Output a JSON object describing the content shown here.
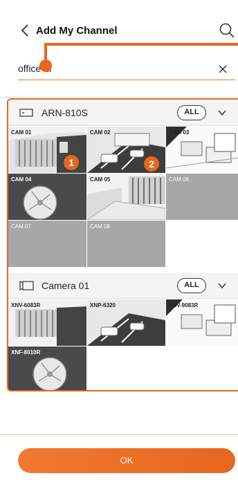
{
  "header": {
    "title": "Add My Channel",
    "back_icon": "chevron-left-icon",
    "search_icon": "search-icon"
  },
  "search": {
    "value": "office 1f",
    "clear_icon": "close-icon"
  },
  "groups": [
    {
      "name": "ARN-810S",
      "icon": "recorder-icon",
      "all_label": "ALL",
      "tiles": [
        {
          "label": "CAM 01",
          "has_image": true
        },
        {
          "label": "CAM 02",
          "has_image": true
        },
        {
          "label": "CAM 03",
          "has_image": true
        },
        {
          "label": "CAM 04",
          "has_image": true
        },
        {
          "label": "CAM 05",
          "has_image": true
        },
        {
          "label": "CAM 06",
          "has_image": false
        },
        {
          "label": "CAM 07",
          "has_image": false
        },
        {
          "label": "CAM 08",
          "has_image": false
        }
      ]
    },
    {
      "name": "Camera 01",
      "icon": "camera-icon",
      "all_label": "ALL",
      "tiles": [
        {
          "label": "XNV-6083R",
          "has_image": true
        },
        {
          "label": "XNP-6320",
          "has_image": true
        },
        {
          "label": "XNV-9083R",
          "has_image": true
        },
        {
          "label": "XNF-8010R",
          "has_image": true
        }
      ]
    }
  ],
  "badges": [
    "1",
    "2"
  ],
  "footer": {
    "ok_label": "OK"
  },
  "colors": {
    "accent": "#e8661e",
    "tile_gray": "#a7a7a7"
  }
}
